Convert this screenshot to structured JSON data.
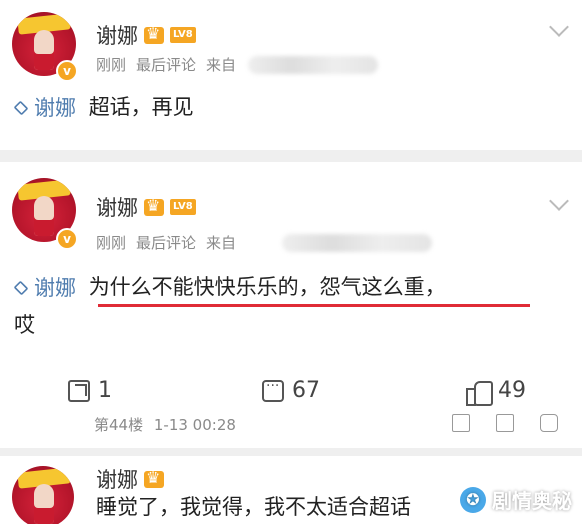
{
  "posts": [
    {
      "user": "谢娜",
      "level": "LV8",
      "time": "刚刚",
      "sort": "最后评论",
      "source_prefix": "来自",
      "topic": "谢娜",
      "text": "超话，再见"
    },
    {
      "user": "谢娜",
      "level": "LV8",
      "time": "刚刚",
      "sort": "最后评论",
      "source_prefix": "来自",
      "topic": "谢娜",
      "text_highlight": "为什么不能快快乐乐的，怨气这么重",
      "text_tail": "，",
      "text_line2": "哎",
      "shares": "1",
      "comments": "67",
      "likes": "49",
      "floor": "第44楼",
      "floor_time": "1-13 00:28"
    },
    {
      "user": "谢娜",
      "text": "睡觉了，我觉得，我不太适合超话"
    }
  ],
  "watermark": "剧情奥秘",
  "colors": {
    "link": "#507daf",
    "underline": "#e02b36",
    "badge": "#f5a623"
  }
}
